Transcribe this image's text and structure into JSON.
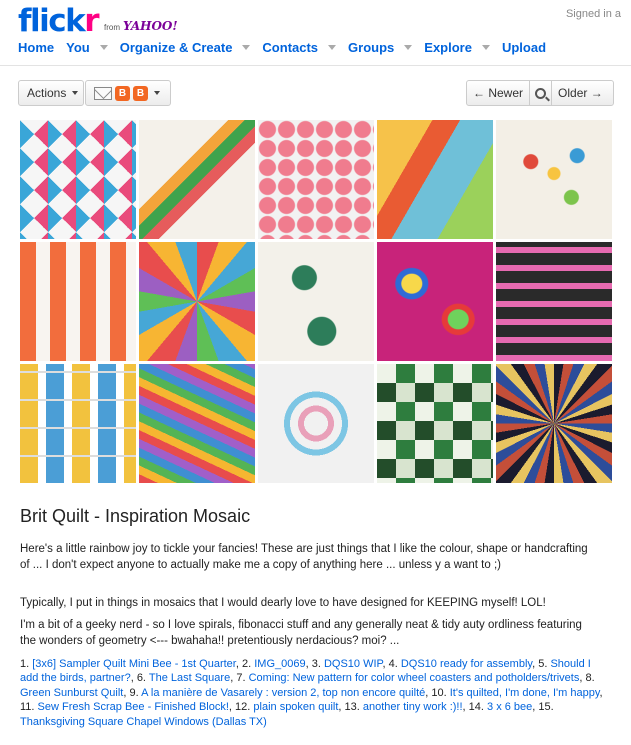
{
  "header": {
    "brand_left": "flick",
    "brand_right": "r",
    "from": "from",
    "yahoo": "YAHOO!",
    "signed_in": "Signed in a"
  },
  "nav": [
    {
      "label": "Home",
      "has_menu": false
    },
    {
      "label": "You",
      "has_menu": true
    },
    {
      "label": "Organize & Create",
      "has_menu": true
    },
    {
      "label": "Contacts",
      "has_menu": true
    },
    {
      "label": "Groups",
      "has_menu": true
    },
    {
      "label": "Explore",
      "has_menu": true
    },
    {
      "label": "Upload",
      "has_menu": false
    }
  ],
  "toolbar": {
    "actions_label": "Actions",
    "newer_label": "← Newer",
    "older_label": "Older →"
  },
  "photo": {
    "title": "Brit Quilt - Inspiration Mosaic",
    "p1": "Here's a little rainbow joy to tickle your fancies! These are just things that I like the colour, shape or handcrafting of ... I don't expect anyone to actually make me a copy of anything here ... unless y a want to ;)",
    "p2": "Typically, I put in things in mosaics that I would dearly love to have designed for KEEPING myself! LOL!",
    "p3": "I'm a bit of a geeky nerd - so I love spirals, fibonacci stuff and any generally neat & tidy auty ordliness featuring the wonders of geometry <--- bwahaha!! pretentiously nerdacious? moi? ..."
  },
  "credits": [
    {
      "n": "1.",
      "title": "[3x6] Sampler Quilt Mini Bee - 1st Quarter",
      "sep": ", "
    },
    {
      "n": "2.",
      "title": "IMG_0069",
      "sep": ", "
    },
    {
      "n": "3.",
      "title": "DQS10 WIP",
      "sep": ", "
    },
    {
      "n": "4.",
      "title": "DQS10 ready for assembly",
      "sep": ", "
    },
    {
      "n": "5.",
      "title": "Should I add the birds, partner?",
      "sep": ", "
    },
    {
      "n": "6.",
      "title": "The Last Square",
      "sep": ", "
    },
    {
      "n": "7.",
      "title": "Coming: New pattern for color wheel coasters and potholders/trivets",
      "sep": ", "
    },
    {
      "n": "8.",
      "title": "Green Sunburst Quilt",
      "sep": ", "
    },
    {
      "n": "9.",
      "title": "A la manière de Vasarely : version 2, top non encore quilté",
      "sep": ", "
    },
    {
      "n": "10.",
      "title": "It's quilted, I'm done, I'm happy",
      "sep": ", "
    },
    {
      "n": "11.",
      "title": "Sew Fresh Scrap Bee - Finished Block!",
      "sep": ", "
    },
    {
      "n": "12.",
      "title": "plain spoken quilt",
      "sep": ", "
    },
    {
      "n": "13.",
      "title": "another tiny work :)!!",
      "sep": ", "
    },
    {
      "n": "14.",
      "title": "3 x 6 bee",
      "sep": ", "
    },
    {
      "n": "15.",
      "title": "Thanksgiving Square Chapel Windows (Dallas TX)",
      "sep": ""
    }
  ],
  "colors": {
    "flickr_blue": "#0063dc",
    "flickr_pink": "#ff0084",
    "yahoo_purple": "#7b0099"
  }
}
